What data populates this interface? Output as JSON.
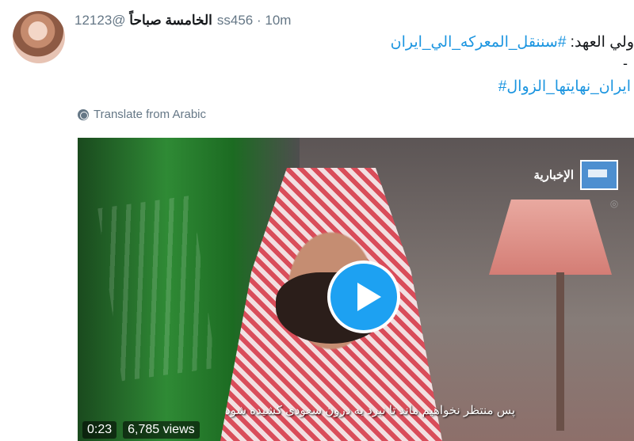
{
  "tweet": {
    "display_name": "الخامسة صباحاً",
    "handle_time": "@12123ss456 · 10m",
    "line1_prefix": "ولي العهد: ",
    "line1_hashtag": "#سننقل_المعركه_الي_ايران",
    "line2": "-",
    "line3_hashtag": "#ايران_نهايتها_الزوال",
    "translate": "Translate from Arabic"
  },
  "video": {
    "channel": "الإخبارية",
    "subtitle": "پس منتظر نخواهیم ماند تا نبرد به درون سعودی کشیده شود",
    "time": "0:23",
    "views": "6,785 views"
  },
  "colors": {
    "link": "#1b95e0",
    "play": "#1da1f2"
  },
  "icons": {
    "translate": "globe-icon",
    "play": "play-icon"
  }
}
